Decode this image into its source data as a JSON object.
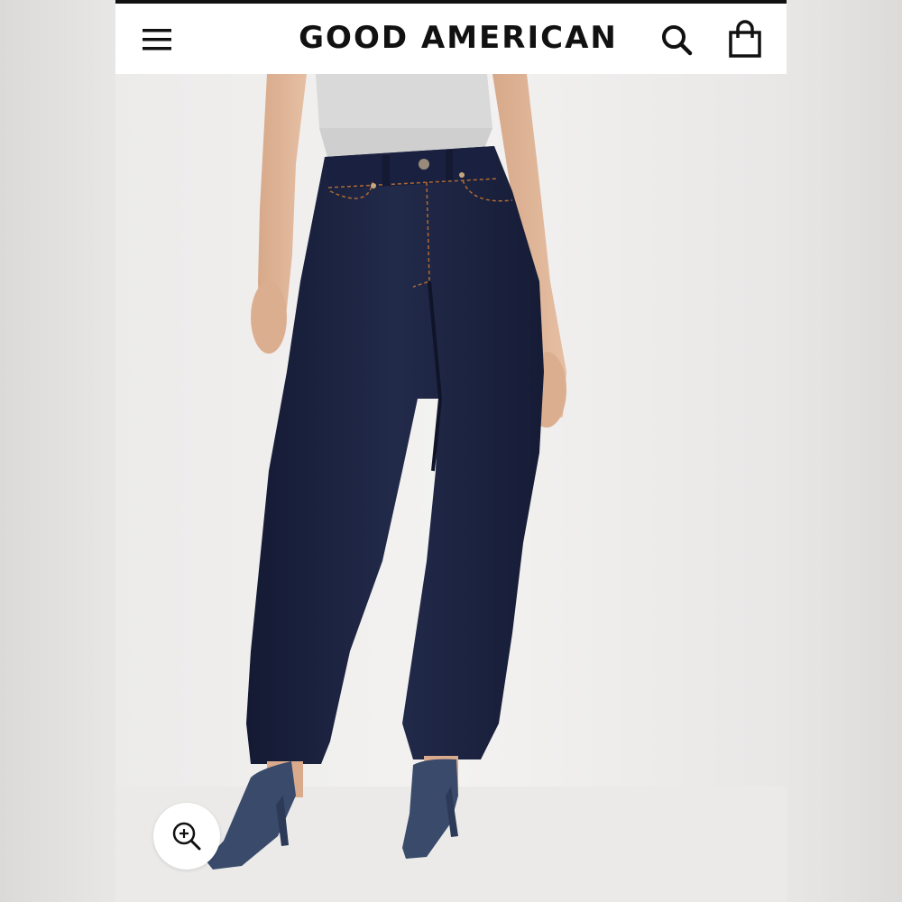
{
  "header": {
    "menu_icon": "hamburger-menu-icon",
    "brand": "GOOD AMERICAN",
    "search_icon": "search-icon",
    "bag_icon": "shopping-bag-icon"
  },
  "product_image": {
    "zoom_icon": "zoom-in-icon"
  },
  "colors": {
    "header_bg": "#ffffff",
    "text": "#111111",
    "denim": "#1c2340",
    "background": "#f1f0ef"
  }
}
